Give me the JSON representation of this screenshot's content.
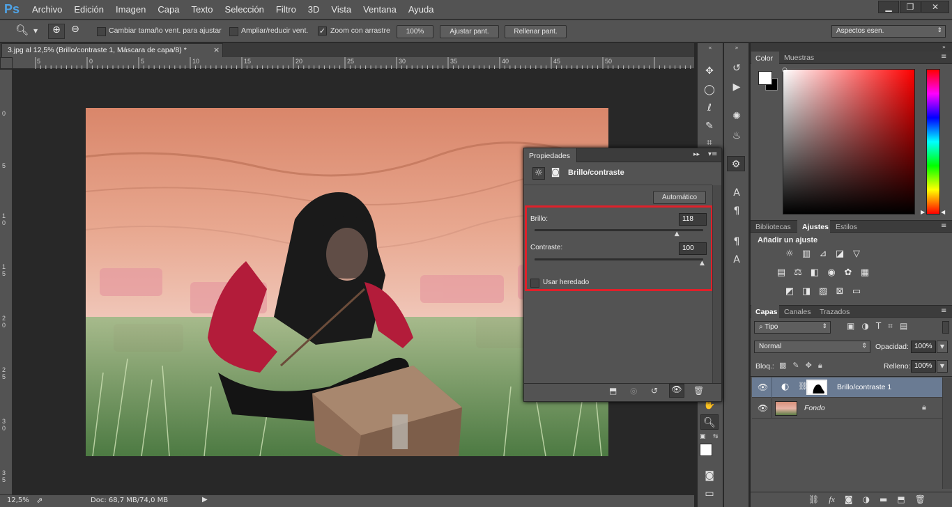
{
  "app": {
    "logo": "Ps"
  },
  "menu": [
    "Archivo",
    "Edición",
    "Imagen",
    "Capa",
    "Texto",
    "Selección",
    "Filtro",
    "3D",
    "Vista",
    "Ventana",
    "Ayuda"
  ],
  "window_controls": {
    "minimize": "▁",
    "restore": "❐",
    "close": "✕"
  },
  "options": {
    "resize_window_label": "Cambiar tamaño vent. para ajustar",
    "zoom_all_label": "Ampliar/reducir vent.",
    "scrubby_zoom_label": "Zoom con arrastre",
    "zoom_value": "100%",
    "fit_screen": "Ajustar pant.",
    "fill_screen": "Rellenar pant.",
    "workspace": "Aspectos esen."
  },
  "document": {
    "tab_title": "3.jpg al 12,5% (Brillo/contraste 1, Máscara de capa/8) *",
    "close_symbol": "×"
  },
  "ruler": {
    "h_labels": [
      "5",
      "0",
      "5",
      "10",
      "15",
      "20",
      "25",
      "30",
      "35",
      "40",
      "45",
      "50"
    ],
    "v_labels": [
      "0",
      "5",
      "1 0",
      "1 5",
      "2 0",
      "2 5",
      "3 0",
      "3 5"
    ]
  },
  "status": {
    "zoom": "12,5%",
    "doc_info": "Doc: 68,7 MB/74,0 MB"
  },
  "properties": {
    "tab": "Propiedades",
    "title": "Brillo/contraste",
    "auto_button": "Automático",
    "brightness_label": "Brillo:",
    "brightness_value": "118",
    "brightness_level": 0.85,
    "contrast_label": "Contraste:",
    "contrast_value": "100",
    "contrast_level": 1.0,
    "legacy_label": "Usar heredado"
  },
  "color_panel": {
    "tabs": [
      "Color",
      "Muestras"
    ],
    "foreground": "#ffffff",
    "background": "#000000"
  },
  "adjust_panel": {
    "tabs": [
      "Bibliotecas",
      "Ajustes",
      "Estilos"
    ],
    "heading": "Añadir un ajuste"
  },
  "layers_panel": {
    "tabs": [
      "Capas",
      "Canales",
      "Trazados"
    ],
    "filter": "Tipo",
    "blend_mode": "Normal",
    "opacity_label": "Opacidad:",
    "opacity_value": "100%",
    "lock_label": "Bloq.:",
    "fill_label": "Relleno:",
    "fill_value": "100%",
    "layers": [
      {
        "name": "Brillo/contraste 1",
        "selected": true
      },
      {
        "name": "Fondo",
        "selected": false
      }
    ]
  },
  "colors": {
    "highlight_border": "#e0202a",
    "selected_layer": "#6a7b93",
    "ps_blue": "#4fa3e6"
  }
}
